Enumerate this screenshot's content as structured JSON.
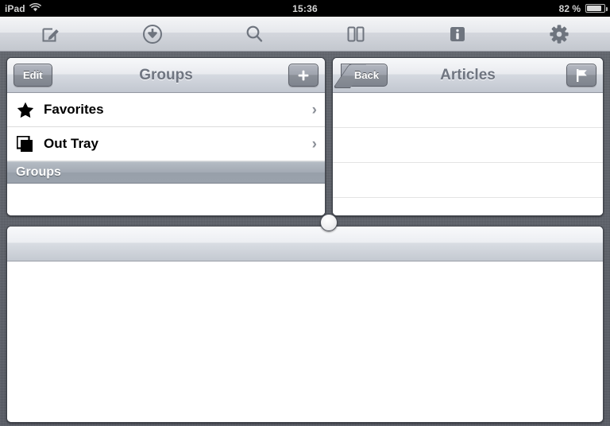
{
  "status_bar": {
    "carrier": "iPad",
    "wifi_icon": "wifi-icon",
    "time": "15:36",
    "battery_percent": "82 %",
    "battery_icon": "battery-icon"
  },
  "toolbar": {
    "items": [
      {
        "name": "compose-icon",
        "label": "Compose"
      },
      {
        "name": "download-icon",
        "label": "Download"
      },
      {
        "name": "search-icon",
        "label": "Search"
      },
      {
        "name": "split-view-icon",
        "label": "Split View"
      },
      {
        "name": "info-icon",
        "label": "Info"
      },
      {
        "name": "gear-icon",
        "label": "Settings"
      }
    ]
  },
  "groups_panel": {
    "title": "Groups",
    "edit_label": "Edit",
    "add_label": "+",
    "rows": [
      {
        "label": "Favorites",
        "icon": "star-icon",
        "chevron": "›"
      },
      {
        "label": "Out Tray",
        "icon": "tray-icon",
        "chevron": "›"
      }
    ],
    "section_header": "Groups",
    "empty_rows": 1
  },
  "articles_panel": {
    "title": "Articles",
    "back_label": "Back",
    "flag_label": "flag-icon",
    "empty_rows": 4
  },
  "detail_panel": {
    "toolbar_empty": true
  },
  "divider": {
    "handle_name": "split-divider-handle"
  },
  "colors": {
    "linen_background": "#5d616b",
    "panel_border": "#3f434b",
    "nav_title": "#6f7580",
    "section_header": "#a3aab4",
    "chevron": "#8a8f97",
    "status_bar_bg": "#000000",
    "status_bar_text": "#cfcfcf"
  }
}
